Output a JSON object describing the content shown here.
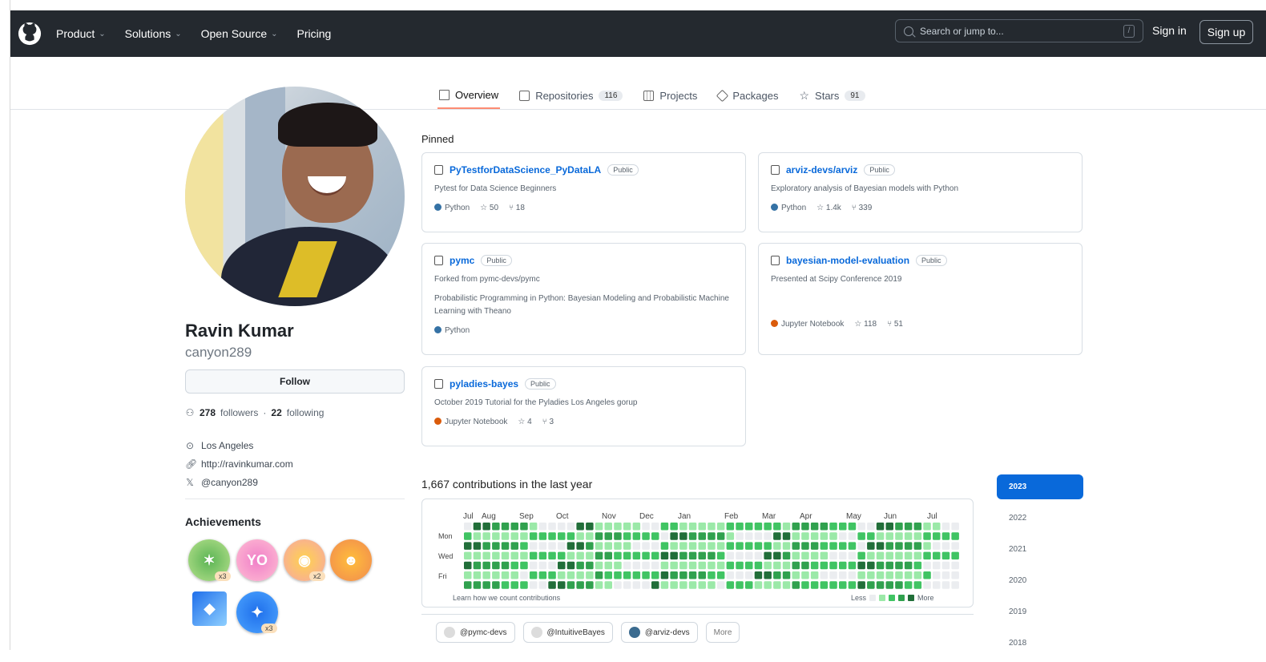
{
  "header": {
    "nav": [
      "Product",
      "Solutions",
      "Open Source",
      "Pricing"
    ],
    "search_placeholder": "Search or jump to...",
    "slash": "/",
    "signin": "Sign in",
    "signup": "Sign up"
  },
  "tabs": [
    {
      "label": "Overview",
      "count": ""
    },
    {
      "label": "Repositories",
      "count": "116"
    },
    {
      "label": "Projects",
      "count": ""
    },
    {
      "label": "Packages",
      "count": ""
    },
    {
      "label": "Stars",
      "count": "91"
    }
  ],
  "profile": {
    "name": "Ravin Kumar",
    "login": "canyon289",
    "follow": "Follow",
    "followers_count": "278",
    "followers_text": "followers",
    "following_count": "22",
    "following_text": "following",
    "location": "Los Angeles",
    "website": "http://ravinkumar.com",
    "twitter": "@canyon289",
    "achievements": "Achievements",
    "achievement_multipliers": [
      "x3",
      "x2",
      "x3"
    ]
  },
  "pinned": {
    "title": "Pinned",
    "repos": [
      {
        "name": "PyTestforDataScience_PyDataLA",
        "visibility": "Public",
        "description": "Pytest for Data Science Beginners",
        "language": "Python",
        "language_color": "#3572A5",
        "stars": "50",
        "forks": "18"
      },
      {
        "name": "arviz-devs/arviz",
        "visibility": "Public",
        "description": "Exploratory analysis of Bayesian models with Python",
        "language": "Python",
        "language_color": "#3572A5",
        "stars": "1.4k",
        "forks": "339"
      },
      {
        "name": "pymc",
        "visibility": "Public",
        "description": "Forked from pymc-devs/pymc",
        "description2": "Probabilistic Programming in Python: Bayesian Modeling and Probabilistic Machine Learning with Theano",
        "language": "Python",
        "language_color": "#3572A5",
        "stars": "",
        "forks": ""
      },
      {
        "name": "bayesian-model-evaluation",
        "visibility": "Public",
        "description": "Presented at Scipy Conference 2019",
        "language": "Jupyter Notebook",
        "language_color": "#DA5B0B",
        "stars": "118",
        "forks": "51"
      },
      {
        "name": "pyladies-bayes",
        "visibility": "Public",
        "description": "October 2019 Tutorial for the Pyladies Los Angeles gorup",
        "language": "Jupyter Notebook",
        "language_color": "#DA5B0B",
        "stars": "4",
        "forks": "3"
      }
    ]
  },
  "contributions": {
    "title": "1,667 contributions in the last year",
    "months": [
      "Jul",
      "Aug",
      "Sep",
      "Oct",
      "Nov",
      "Dec",
      "Jan",
      "Feb",
      "Mar",
      "Apr",
      "May",
      "Jun",
      "Jul"
    ],
    "days": [
      "Mon",
      "Wed",
      "Fri"
    ],
    "learn": "Learn how we count contributions",
    "less": "Less",
    "more": "More",
    "colors": [
      "#ebedf0",
      "#9be9a8",
      "#40c463",
      "#30a14e",
      "#216e39"
    ]
  },
  "years": [
    "2023",
    "2022",
    "2021",
    "2020",
    "2019",
    "2018"
  ],
  "orgs": [
    {
      "label": "@pymc-devs"
    },
    {
      "label": "@IntuitiveBayes"
    },
    {
      "label": "@arviz-devs"
    },
    {
      "label": "More"
    }
  ]
}
